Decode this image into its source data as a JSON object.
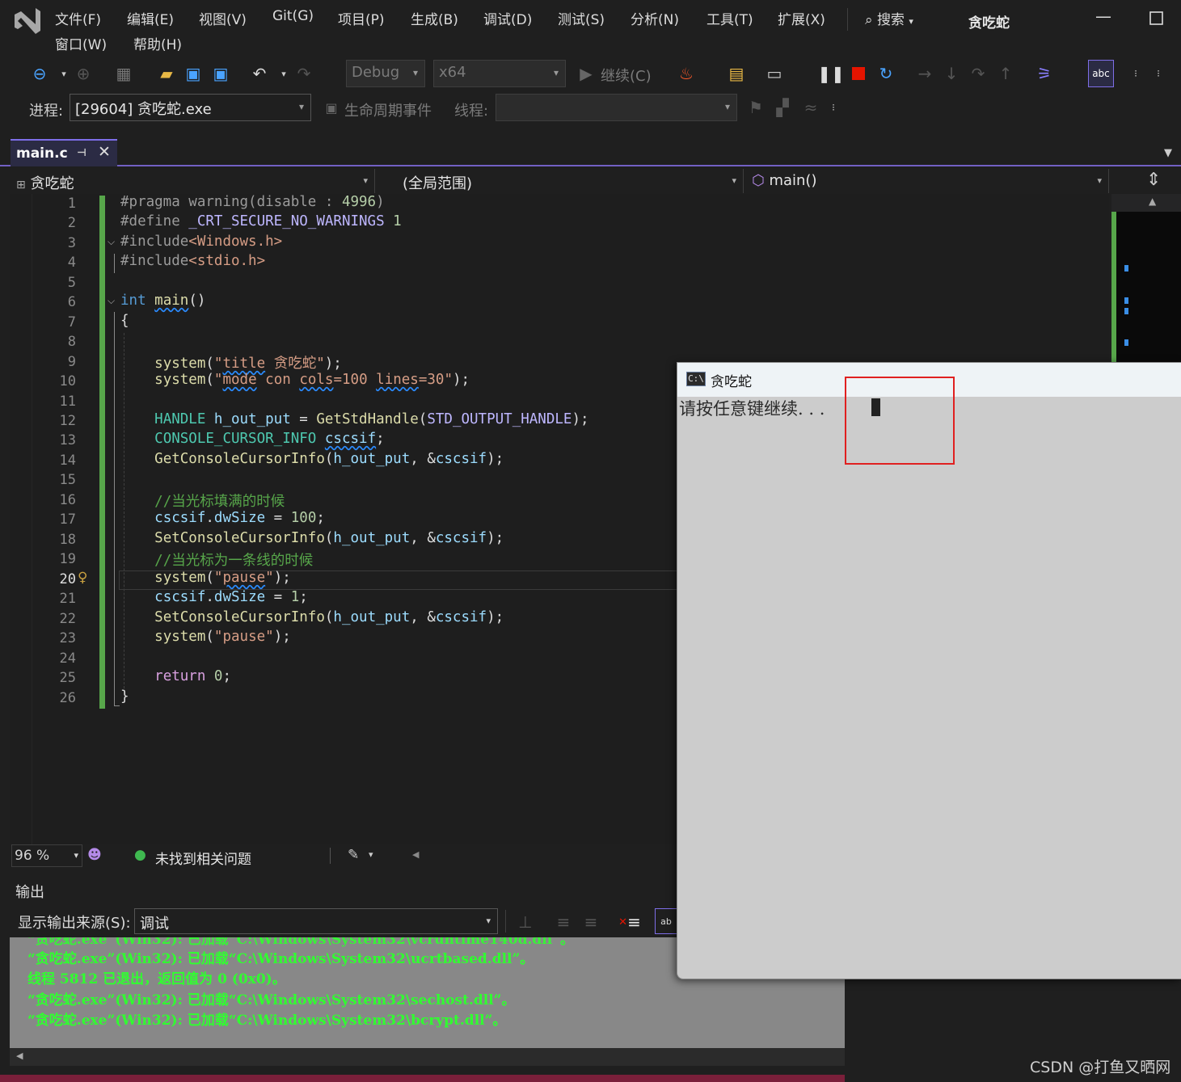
{
  "menubar": {
    "items": [
      "文件(F)",
      "编辑(E)",
      "视图(V)",
      "Git(G)",
      "项目(P)",
      "生成(B)",
      "调试(D)",
      "测试(S)",
      "分析(N)",
      "工具(T)",
      "扩展(X)",
      "窗口(W)",
      "帮助(H)"
    ],
    "search_label": "搜索",
    "solution_title": "贪吃蛇"
  },
  "toolbar": {
    "config": "Debug",
    "platform": "x64",
    "continue_label": "继续(C)",
    "process_label": "进程:",
    "process_value": "[29604] 贪吃蛇.exe",
    "lifecycle_label": "生命周期事件",
    "thread_label": "线程:"
  },
  "tab": {
    "label": "main.c"
  },
  "navbar": {
    "project": "贪吃蛇",
    "scope": "(全局范围)",
    "member": "main()"
  },
  "editor": {
    "line_numbers": [
      "1",
      "2",
      "3",
      "4",
      "5",
      "6",
      "7",
      "8",
      "9",
      "10",
      "11",
      "12",
      "13",
      "14",
      "15",
      "16",
      "17",
      "18",
      "19",
      "20",
      "21",
      "22",
      "23",
      "24",
      "25",
      "26"
    ],
    "current_line": "20"
  },
  "editor_status": {
    "zoom": "96 %",
    "issues": "未找到相关问题"
  },
  "output": {
    "title": "输出",
    "source_label": "显示输出来源(S):",
    "source_value": "调试",
    "lines": [
      "“贪吃蛇.exe”(Win32): 已加载“C:\\Windows\\System32\\ucrtbased.dll”。",
      "线程 5812 已退出，返回值为 0 (0x0)。",
      "“贪吃蛇.exe”(Win32): 已加载“C:\\Windows\\System32\\sechost.dll”。",
      "“贪吃蛇.exe”(Win32): 已加载“C:\\Windows\\System32\\bcrypt.dll”。"
    ]
  },
  "console": {
    "icon_text": "C:\\",
    "title": "贪吃蛇",
    "text": "请按任意键继续. . ."
  },
  "watermark": "CSDN @打鱼又晒网",
  "colors": {
    "accent": "#7e6ee8",
    "green_bar": "#57a64a",
    "highlight": "#e02020",
    "output_text": "#30ff30"
  }
}
